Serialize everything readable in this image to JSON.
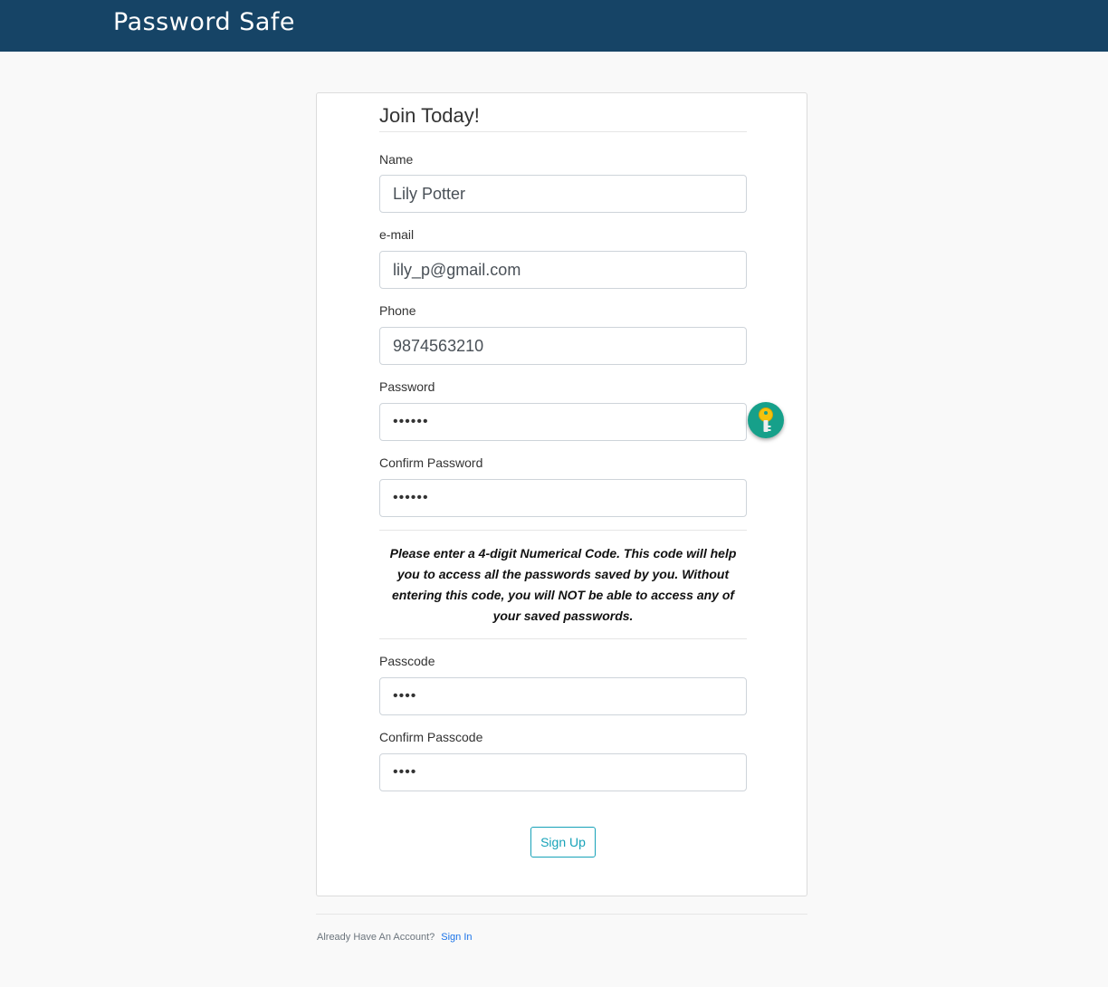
{
  "header": {
    "brand": "Password Safe"
  },
  "form": {
    "legend": "Join Today!",
    "fields": {
      "name": {
        "label": "Name",
        "value": "Lily Potter"
      },
      "email": {
        "label": "e-mail",
        "value": "lily_p@gmail.com"
      },
      "phone": {
        "label": "Phone",
        "value": "9874563210"
      },
      "password": {
        "label": "Password",
        "value": "••••••"
      },
      "confirm_password": {
        "label": "Confirm Password",
        "value": "••••••"
      },
      "passcode": {
        "label": "Passcode",
        "value": "••••"
      },
      "confirm_passcode": {
        "label": "Confirm Passcode",
        "value": "••••"
      }
    },
    "notice": "Please enter a 4-digit Numerical Code. This code will help you to access all the passwords saved by you. Without entering this code, you will NOT be able to access any of your saved passwords.",
    "submit_label": "Sign Up"
  },
  "footer": {
    "text": "Already Have An Account?",
    "link": "Sign In"
  },
  "colors": {
    "navbar": "#164466",
    "accent": "#17a2b8",
    "key_button": "#16a08a",
    "link": "#1a73e8"
  },
  "icons": {
    "generate_password": "key-icon"
  }
}
